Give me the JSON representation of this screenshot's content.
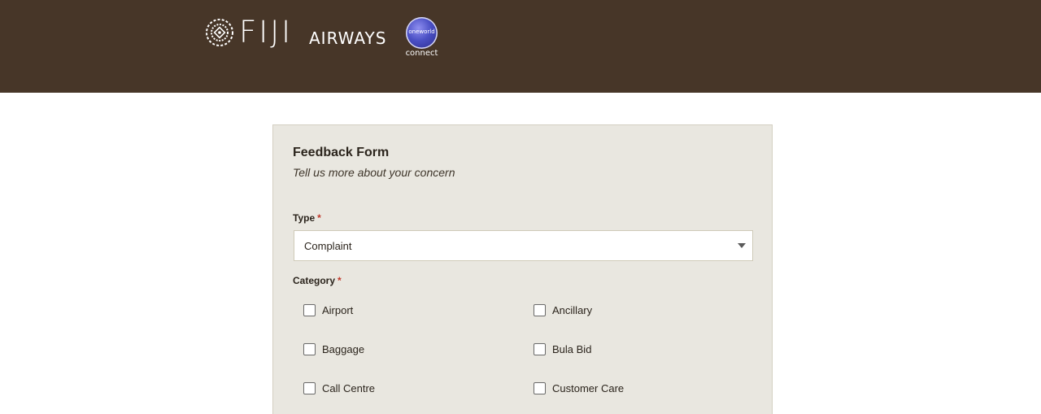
{
  "header": {
    "brand_primary": "FIJI",
    "brand_secondary": "AIRWAYS",
    "alliance_badge_text": "oneworld",
    "alliance_caption": "connect",
    "background_color": "#473628"
  },
  "form": {
    "title": "Feedback Form",
    "subtitle": "Tell us more about your concern",
    "type_label": "Type",
    "type_required_mark": "*",
    "type_selected": "Complaint",
    "category_label": "Category",
    "category_required_mark": "*",
    "categories": [
      {
        "label": "Airport",
        "checked": false
      },
      {
        "label": "Ancillary",
        "checked": false
      },
      {
        "label": "Baggage",
        "checked": false
      },
      {
        "label": "Bula Bid",
        "checked": false
      },
      {
        "label": "Call Centre",
        "checked": false
      },
      {
        "label": "Customer Care",
        "checked": false
      }
    ]
  },
  "colors": {
    "panel_bg": "#e9e7e0",
    "required": "#c0392b"
  }
}
